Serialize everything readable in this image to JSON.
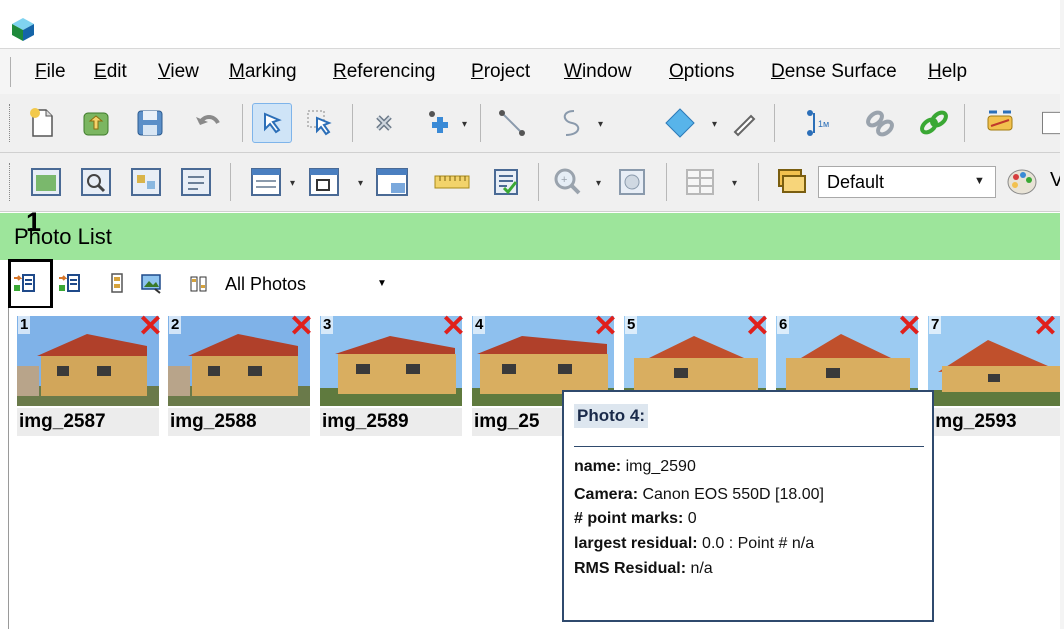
{
  "menu": {
    "items": [
      {
        "id": "file",
        "mnemonic": "F",
        "rest": "ile"
      },
      {
        "id": "edit",
        "mnemonic": "E",
        "rest": "dit"
      },
      {
        "id": "view",
        "mnemonic": "V",
        "rest": "iew"
      },
      {
        "id": "marking",
        "mnemonic": "M",
        "rest": "arking"
      },
      {
        "id": "referencing",
        "mnemonic": "R",
        "rest": "eferencing"
      },
      {
        "id": "project",
        "mnemonic": "P",
        "rest": "roject"
      },
      {
        "id": "window",
        "mnemonic": "W",
        "rest": "indow"
      },
      {
        "id": "options",
        "mnemonic": "O",
        "rest": "ptions"
      },
      {
        "id": "dense-surface",
        "mnemonic": "D",
        "rest": "ense Surface"
      },
      {
        "id": "help",
        "mnemonic": "H",
        "rest": "elp"
      }
    ]
  },
  "toolbar2": {
    "style_value": "Default",
    "cut_text": "V"
  },
  "callout": {
    "number": "1"
  },
  "photo_list": {
    "title": "Photo List",
    "filter_value": "All Photos"
  },
  "photos": [
    {
      "num": "1",
      "name": "img_2587",
      "x_mark": "✕"
    },
    {
      "num": "2",
      "name": "img_2588",
      "x_mark": "✕"
    },
    {
      "num": "3",
      "name": "img_2589",
      "x_mark": "✕"
    },
    {
      "num": "4",
      "name": "img_25",
      "x_mark": "✕"
    },
    {
      "num": "5",
      "name": "",
      "x_mark": "✕"
    },
    {
      "num": "6",
      "name": "",
      "x_mark": "✕"
    },
    {
      "num": "7",
      "name": "img_2593",
      "x_mark": "✕"
    }
  ],
  "tooltip": {
    "title": "Photo 4:",
    "name_label": "name:",
    "name_value": " img_2590",
    "camera_label": "Camera:",
    "camera_value": " Canon EOS 550D [18.00]",
    "marks_label": "# point marks:",
    "marks_value": " 0",
    "residual_label": "largest residual:",
    "residual_value": " 0.0 : Point # n/a",
    "rms_label": "RMS Residual:",
    "rms_value": " n/a"
  },
  "colors": {
    "photo_list_header": "#9de59b",
    "tooltip_border": "#2f4a6d",
    "reject_mark": "#e0201c"
  }
}
